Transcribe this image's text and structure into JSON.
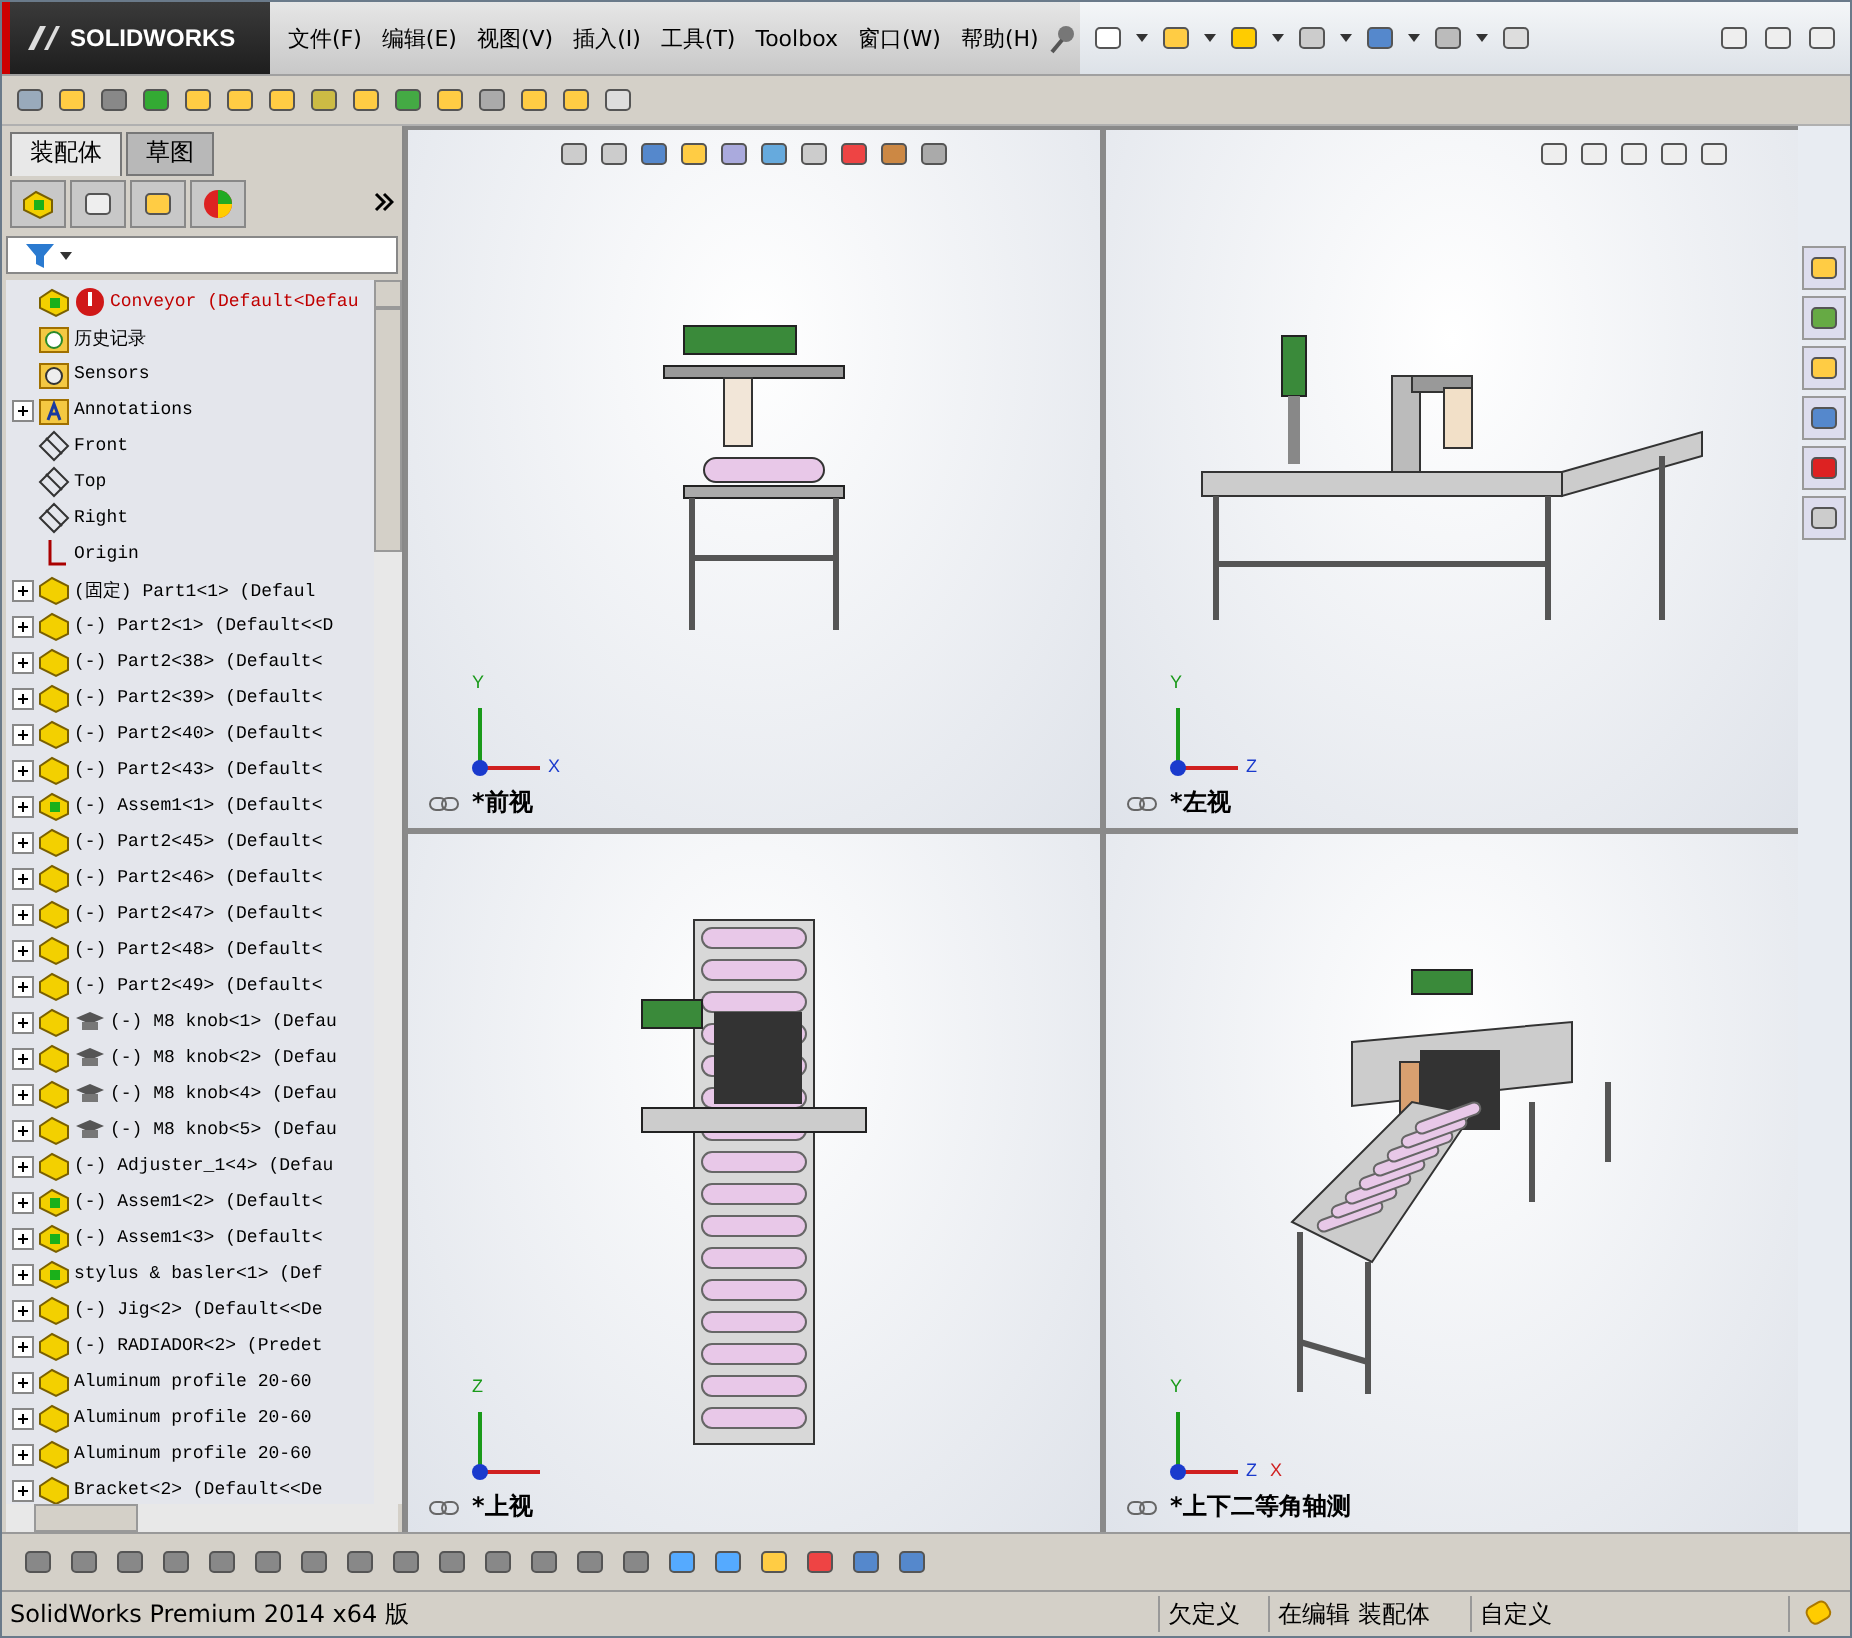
{
  "app": {
    "logo": "SOLIDWORKS",
    "menu": [
      "文件(F)",
      "编辑(E)",
      "视图(V)",
      "插入(I)",
      "工具(T)",
      "Toolbox",
      "窗口(W)",
      "帮助(H)"
    ]
  },
  "panel": {
    "tabs": [
      {
        "label": "装配体",
        "selected": true
      },
      {
        "label": "草图",
        "selected": false
      }
    ],
    "tree": [
      {
        "kind": "root",
        "text": "Conveyor  (Default<Defau",
        "collapsible": false
      },
      {
        "kind": "history",
        "text": "历史记录",
        "collapsible": false
      },
      {
        "kind": "sensors",
        "text": "Sensors",
        "collapsible": false
      },
      {
        "kind": "annotations",
        "text": "Annotations",
        "collapsible": true
      },
      {
        "kind": "plane",
        "text": "Front",
        "collapsible": false
      },
      {
        "kind": "plane",
        "text": "Top",
        "collapsible": false
      },
      {
        "kind": "plane",
        "text": "Right",
        "collapsible": false
      },
      {
        "kind": "origin",
        "text": "Origin",
        "collapsible": false
      },
      {
        "kind": "part",
        "text": "(固定) Part1<1> (Defaul",
        "collapsible": true
      },
      {
        "kind": "part",
        "text": "(-) Part2<1> (Default<<D",
        "collapsible": true
      },
      {
        "kind": "part",
        "text": "(-) Part2<38> (Default<",
        "collapsible": true
      },
      {
        "kind": "part",
        "text": "(-) Part2<39> (Default<",
        "collapsible": true
      },
      {
        "kind": "part",
        "text": "(-) Part2<40> (Default<",
        "collapsible": true
      },
      {
        "kind": "part",
        "text": "(-) Part2<43> (Default<",
        "collapsible": true
      },
      {
        "kind": "assembly",
        "text": "(-) Assem1<1> (Default<",
        "collapsible": true
      },
      {
        "kind": "part",
        "text": "(-) Part2<45> (Default<",
        "collapsible": true
      },
      {
        "kind": "part",
        "text": "(-) Part2<46> (Default<",
        "collapsible": true
      },
      {
        "kind": "part",
        "text": "(-) Part2<47> (Default<",
        "collapsible": true
      },
      {
        "kind": "part",
        "text": "(-) Part2<48> (Default<",
        "collapsible": true
      },
      {
        "kind": "part",
        "text": "(-) Part2<49> (Default<",
        "collapsible": true
      },
      {
        "kind": "toolbox",
        "text": "(-) M8 knob<1> (Defau",
        "collapsible": true
      },
      {
        "kind": "toolbox",
        "text": "(-) M8 knob<2> (Defau",
        "collapsible": true
      },
      {
        "kind": "toolbox",
        "text": "(-) M8 knob<4> (Defau",
        "collapsible": true
      },
      {
        "kind": "toolbox",
        "text": "(-) M8 knob<5> (Defau",
        "collapsible": true
      },
      {
        "kind": "part",
        "text": "(-) Adjuster_1<4> (Defau",
        "collapsible": true
      },
      {
        "kind": "assembly",
        "text": "(-) Assem1<2> (Default<",
        "collapsible": true
      },
      {
        "kind": "assembly",
        "text": "(-) Assem1<3> (Default<",
        "collapsible": true
      },
      {
        "kind": "assembly",
        "text": "stylus & basler<1> (Def",
        "collapsible": true
      },
      {
        "kind": "part",
        "text": "(-) Jig<2> (Default<<De",
        "collapsible": true
      },
      {
        "kind": "part",
        "text": "(-) RADIADOR<2> (Predet",
        "collapsible": true
      },
      {
        "kind": "part",
        "text": "Aluminum profile  20-60",
        "collapsible": true
      },
      {
        "kind": "part",
        "text": "Aluminum profile  20-60",
        "collapsible": true
      },
      {
        "kind": "part",
        "text": "Aluminum profile  20-60",
        "collapsible": true
      },
      {
        "kind": "part",
        "text": "Bracket<2> (Default<<De",
        "collapsible": true
      }
    ]
  },
  "views": [
    {
      "kind": "front",
      "label": "*前视",
      "axes": [
        "Y",
        "X"
      ]
    },
    {
      "kind": "left",
      "label": "*左视",
      "axes": [
        "Y",
        "Z"
      ]
    },
    {
      "kind": "top",
      "label": "*上视",
      "axes": [
        "Z"
      ]
    },
    {
      "kind": "iso",
      "label": "*上下二等角轴测",
      "axes": [
        "Y",
        "Z",
        "X"
      ]
    }
  ],
  "status_bar": [
    "SolidWorks Premium 2014 x64 版",
    "欠定义",
    "在编辑 装配体",
    "自定义"
  ]
}
